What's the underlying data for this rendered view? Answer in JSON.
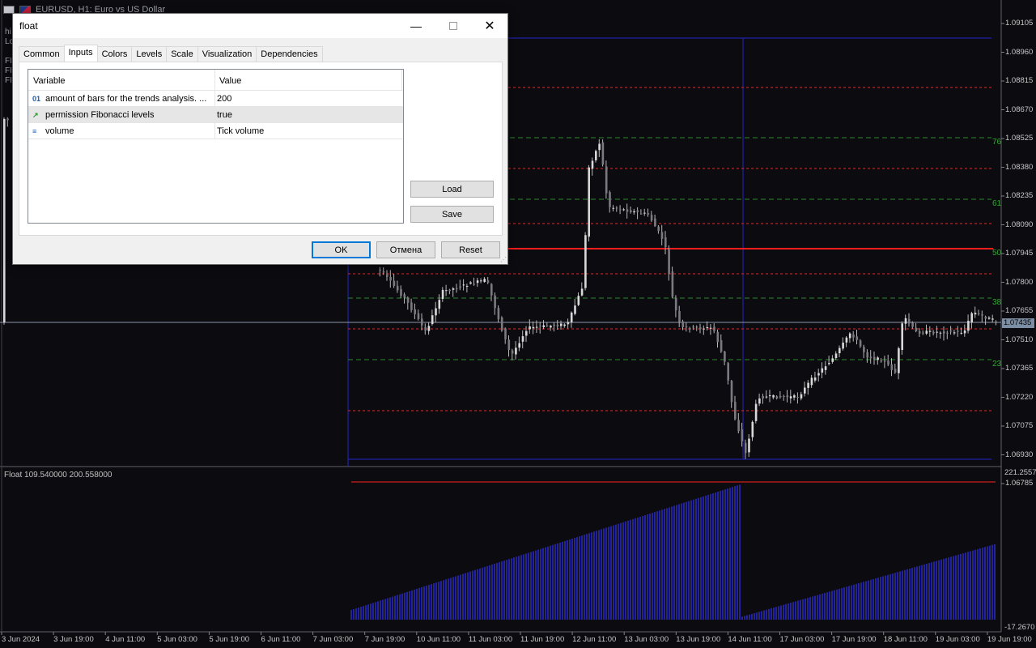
{
  "chart": {
    "header_symbol": "EURUSD, H1:  Euro vs US Dollar",
    "side_labels": [
      "hi",
      "Lo",
      "",
      "FI",
      "FI",
      "FI"
    ],
    "price_ticks": [
      "1.09105",
      "1.08960",
      "1.08815",
      "1.08670",
      "1.08525",
      "1.08380",
      "1.08235",
      "1.08090",
      "1.07945",
      "1.07800",
      "1.07655",
      "1.07510",
      "1.07365",
      "1.07220",
      "1.07075",
      "1.06930",
      "1.06785"
    ],
    "current_price": "1.07435",
    "fib_labels": [
      "76",
      "61",
      "50",
      "38",
      "23"
    ],
    "time_ticks": [
      "3 Jun 2024",
      "3 Jun 19:00",
      "4 Jun 11:00",
      "5 Jun 03:00",
      "5 Jun 19:00",
      "6 Jun 11:00",
      "7 Jun 03:00",
      "7 Jun 19:00",
      "10 Jun 11:00",
      "11 Jun 03:00",
      "11 Jun 19:00",
      "12 Jun 11:00",
      "13 Jun 03:00",
      "13 Jun 19:00",
      "14 Jun 11:00",
      "17 Jun 03:00",
      "17 Jun 19:00",
      "18 Jun 11:00",
      "19 Jun 03:00",
      "19 Jun 19:00"
    ],
    "subwindow_title": "Float 109.540000 200.558000",
    "sub_scale_top": "221.2557",
    "sub_scale_bottom": "-17.2670",
    "colors": {
      "background": "#0b0b10",
      "candle": "#b8b8b8",
      "box": "#2525cc",
      "fib_red": "#cc3030",
      "fib_green": "#2a8a2a",
      "main_level": "#ff1e1e",
      "histogram": "#2a2ab8"
    }
  },
  "dialog": {
    "title": "float",
    "minimize_glyph": "—",
    "close_glyph": "✕",
    "tabs": [
      {
        "label": "Common"
      },
      {
        "label": "Inputs"
      },
      {
        "label": "Colors"
      },
      {
        "label": "Levels"
      },
      {
        "label": "Scale"
      },
      {
        "label": "Visualization"
      },
      {
        "label": "Dependencies"
      }
    ],
    "active_tab": "Inputs",
    "grid": {
      "col_variable": "Variable",
      "col_value": "Value",
      "rows": [
        {
          "icon": "01",
          "icon_name": "integer-icon",
          "variable": "amount of bars for the trends analysis. ...",
          "value": "200"
        },
        {
          "icon": "↗",
          "icon_name": "bool-icon",
          "variable": "permission Fibonacci levels",
          "value": "true"
        },
        {
          "icon": "≡",
          "icon_name": "enum-icon",
          "variable": "volume",
          "value": "Tick volume"
        }
      ]
    },
    "buttons": {
      "load": "Load",
      "save": "Save",
      "ok": "OK",
      "cancel": "Отмена",
      "reset": "Reset"
    }
  }
}
